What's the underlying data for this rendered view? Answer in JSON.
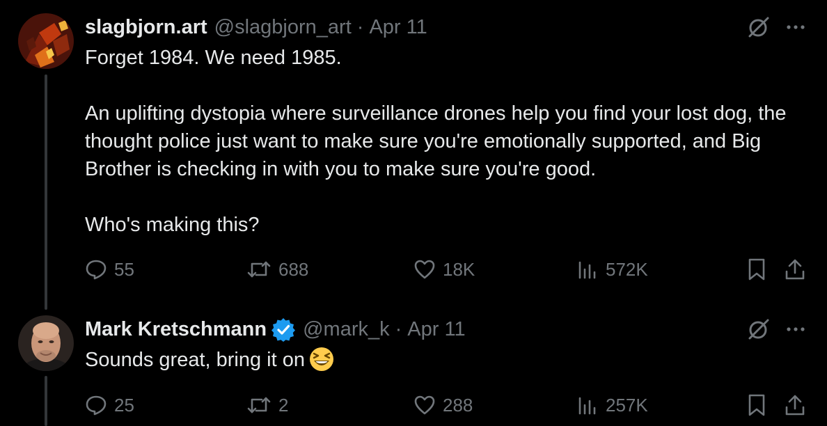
{
  "tweets": [
    {
      "display_name": "slagbjorn.art",
      "verified": false,
      "handle": "@slagbjorn_art",
      "separator": "·",
      "date": "Apr 11",
      "paragraphs": [
        "Forget 1984. We need 1985.",
        "An uplifting dystopia where surveillance drones help you find your lost dog, the thought police just want to make sure you're emotionally supported, and Big Brother is checking in with you to make sure you're good.",
        "Who's making this?"
      ],
      "stats": {
        "replies": "55",
        "reposts": "688",
        "likes": "18K",
        "views": "572K"
      }
    },
    {
      "display_name": "Mark Kretschmann",
      "verified": true,
      "handle": "@mark_k",
      "separator": "·",
      "date": "Apr 11",
      "text": "Sounds great, bring it on",
      "emoji": "grinning-squinting-face",
      "stats": {
        "replies": "25",
        "reposts": "2",
        "likes": "288",
        "views": "257K"
      }
    }
  ],
  "colors": {
    "background": "#000000",
    "text_primary": "#e7e9ea",
    "text_secondary": "#71767b",
    "thread_line": "#333639",
    "verified_blue": "#1d9bf0"
  },
  "icons": {
    "grok": "grok-icon",
    "more": "more-icon",
    "reply": "reply-icon",
    "repost": "repost-icon",
    "like": "like-icon",
    "views": "views-icon",
    "bookmark": "bookmark-icon",
    "share": "share-icon",
    "verified": "verified-badge-icon"
  }
}
